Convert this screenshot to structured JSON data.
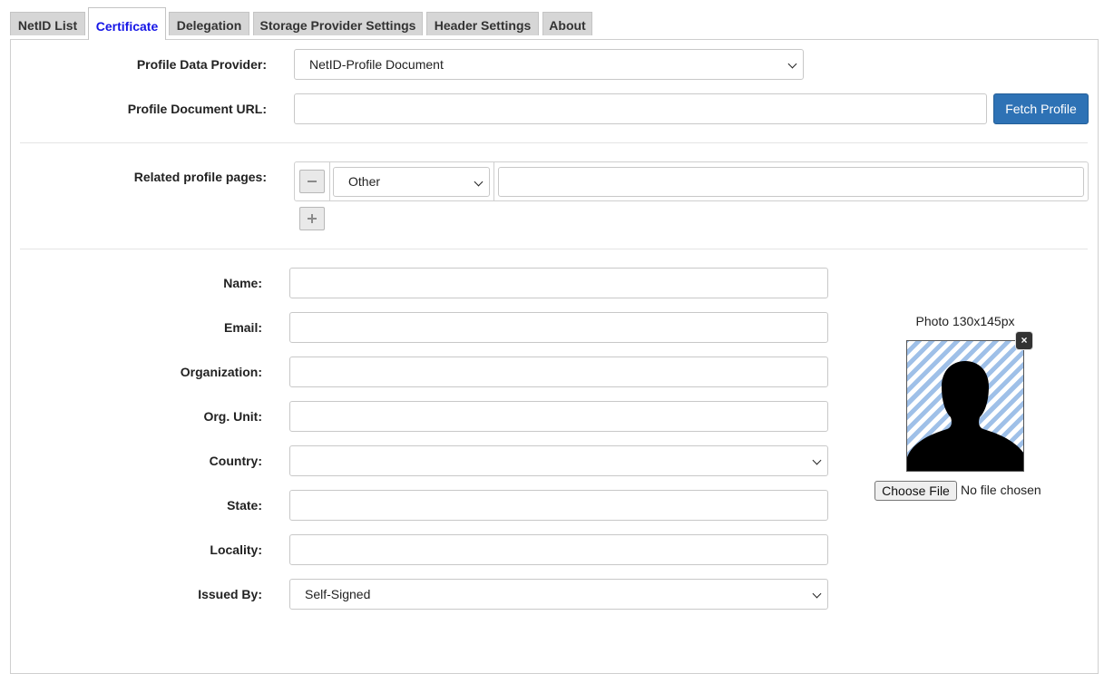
{
  "tabs": [
    {
      "label": "NetID List"
    },
    {
      "label": "Certificate"
    },
    {
      "label": "Delegation"
    },
    {
      "label": "Storage Provider Settings"
    },
    {
      "label": "Header Settings"
    },
    {
      "label": "About"
    }
  ],
  "active_tab": "Certificate",
  "profile": {
    "provider_label": "Profile Data Provider:",
    "provider_value": "NetID-Profile Document",
    "url_label": "Profile Document URL:",
    "url_value": "",
    "fetch_button": "Fetch Profile"
  },
  "related": {
    "label": "Related profile pages:",
    "type_value": "Other",
    "url_value": ""
  },
  "fields": {
    "name_label": "Name:",
    "email_label": "Email:",
    "organization_label": "Organization:",
    "org_unit_label": "Org. Unit:",
    "country_label": "Country:",
    "country_value": "",
    "state_label": "State:",
    "locality_label": "Locality:",
    "issued_by_label": "Issued By:",
    "issued_by_value": "Self-Signed"
  },
  "photo": {
    "label": "Photo 130x145px",
    "close_icon_glyph": "×",
    "file_button": "Choose File",
    "file_status": "No file chosen"
  },
  "colors": {
    "active_tab_text": "#1515e6",
    "primary_button": "#2e72b5",
    "tab_background": "#d6d6d6"
  }
}
